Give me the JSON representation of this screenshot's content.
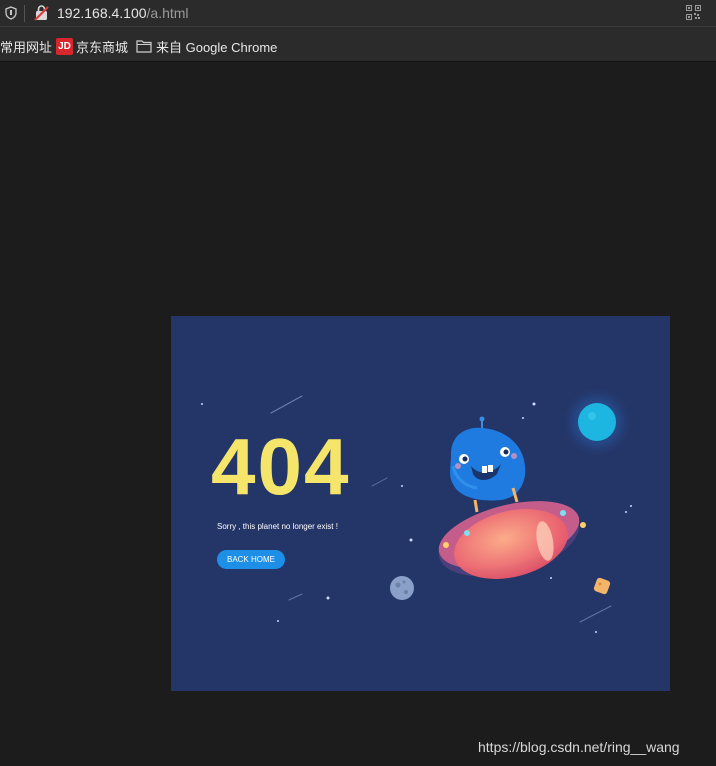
{
  "browser": {
    "url_host": "192.168.4.100",
    "url_path": "/a.html",
    "icons": [
      "shield-icon",
      "insecure-lock-icon",
      "qr-code-icon"
    ]
  },
  "bookmarks": [
    {
      "label": "常用网址",
      "icon": ""
    },
    {
      "label": "京东商城",
      "icon": "jd-icon",
      "icon_text": "JD"
    },
    {
      "label": "来自 Google Chrome",
      "icon": "folder-icon"
    }
  ],
  "page": {
    "heading": "404",
    "message": "Sorry , this planet no longer exist !",
    "button_label": "BACK HOME",
    "colors": {
      "background": "#243567",
      "heading": "#f5e66b",
      "button": "#1e8fe6",
      "planet": "#1cb6e0"
    }
  },
  "watermark": "https://blog.csdn.net/ring__wang"
}
